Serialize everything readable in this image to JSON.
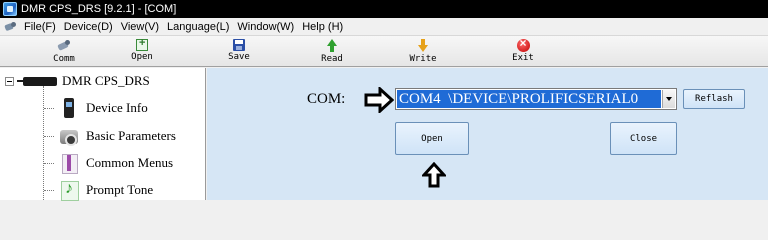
{
  "window": {
    "title": "DMR CPS_DRS [9.2.1] - [COM]"
  },
  "menu": {
    "items": [
      "File(F)",
      "Device(D)",
      "View(V)",
      "Language(L)",
      "Window(W)",
      "Help (H)"
    ]
  },
  "toolbar": {
    "buttons": [
      {
        "label": "Comm",
        "icon": "comm-icon"
      },
      {
        "label": "Open",
        "icon": "open-icon"
      },
      {
        "label": "Save",
        "icon": "save-icon"
      },
      {
        "label": "Read",
        "icon": "read-icon"
      },
      {
        "label": "Write",
        "icon": "write-icon"
      },
      {
        "label": "Exit",
        "icon": "exit-icon"
      }
    ]
  },
  "tree": {
    "root": "DMR CPS_DRS",
    "items": [
      {
        "label": "Device Info",
        "icon": "device-info-icon"
      },
      {
        "label": "Basic Parameters",
        "icon": "basic-parameters-icon"
      },
      {
        "label": "Common Menus",
        "icon": "common-menus-icon"
      },
      {
        "label": "Prompt Tone",
        "icon": "prompt-tone-icon"
      }
    ]
  },
  "com": {
    "label": "COM:",
    "selected_port": "COM4  \\DEVICE\\PROLIFICSERIAL0",
    "reflash_label": "Reflash",
    "open_label": "Open",
    "close_label": "Close"
  },
  "colors": {
    "titlebar": "#000000",
    "main_background": "#d6e6f5",
    "selection": "#1f6bd6"
  }
}
